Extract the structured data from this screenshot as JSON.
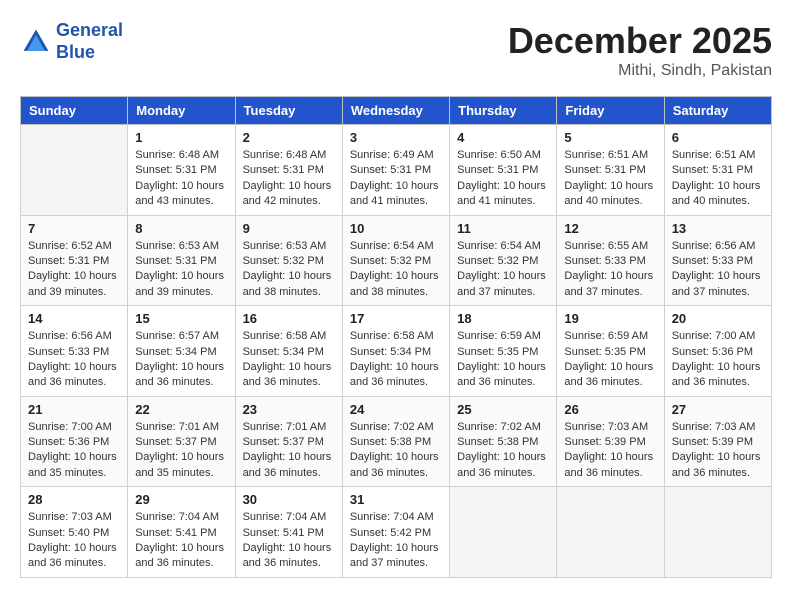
{
  "header": {
    "logo_line1": "General",
    "logo_line2": "Blue",
    "month_year": "December 2025",
    "location": "Mithi, Sindh, Pakistan"
  },
  "weekdays": [
    "Sunday",
    "Monday",
    "Tuesday",
    "Wednesday",
    "Thursday",
    "Friday",
    "Saturday"
  ],
  "weeks": [
    [
      {
        "day": "",
        "empty": true
      },
      {
        "day": "1",
        "sunrise": "6:48 AM",
        "sunset": "5:31 PM",
        "daylight": "10 hours and 43 minutes."
      },
      {
        "day": "2",
        "sunrise": "6:48 AM",
        "sunset": "5:31 PM",
        "daylight": "10 hours and 42 minutes."
      },
      {
        "day": "3",
        "sunrise": "6:49 AM",
        "sunset": "5:31 PM",
        "daylight": "10 hours and 41 minutes."
      },
      {
        "day": "4",
        "sunrise": "6:50 AM",
        "sunset": "5:31 PM",
        "daylight": "10 hours and 41 minutes."
      },
      {
        "day": "5",
        "sunrise": "6:51 AM",
        "sunset": "5:31 PM",
        "daylight": "10 hours and 40 minutes."
      },
      {
        "day": "6",
        "sunrise": "6:51 AM",
        "sunset": "5:31 PM",
        "daylight": "10 hours and 40 minutes."
      }
    ],
    [
      {
        "day": "7",
        "sunrise": "6:52 AM",
        "sunset": "5:31 PM",
        "daylight": "10 hours and 39 minutes."
      },
      {
        "day": "8",
        "sunrise": "6:53 AM",
        "sunset": "5:31 PM",
        "daylight": "10 hours and 39 minutes."
      },
      {
        "day": "9",
        "sunrise": "6:53 AM",
        "sunset": "5:32 PM",
        "daylight": "10 hours and 38 minutes."
      },
      {
        "day": "10",
        "sunrise": "6:54 AM",
        "sunset": "5:32 PM",
        "daylight": "10 hours and 38 minutes."
      },
      {
        "day": "11",
        "sunrise": "6:54 AM",
        "sunset": "5:32 PM",
        "daylight": "10 hours and 37 minutes."
      },
      {
        "day": "12",
        "sunrise": "6:55 AM",
        "sunset": "5:33 PM",
        "daylight": "10 hours and 37 minutes."
      },
      {
        "day": "13",
        "sunrise": "6:56 AM",
        "sunset": "5:33 PM",
        "daylight": "10 hours and 37 minutes."
      }
    ],
    [
      {
        "day": "14",
        "sunrise": "6:56 AM",
        "sunset": "5:33 PM",
        "daylight": "10 hours and 36 minutes."
      },
      {
        "day": "15",
        "sunrise": "6:57 AM",
        "sunset": "5:34 PM",
        "daylight": "10 hours and 36 minutes."
      },
      {
        "day": "16",
        "sunrise": "6:58 AM",
        "sunset": "5:34 PM",
        "daylight": "10 hours and 36 minutes."
      },
      {
        "day": "17",
        "sunrise": "6:58 AM",
        "sunset": "5:34 PM",
        "daylight": "10 hours and 36 minutes."
      },
      {
        "day": "18",
        "sunrise": "6:59 AM",
        "sunset": "5:35 PM",
        "daylight": "10 hours and 36 minutes."
      },
      {
        "day": "19",
        "sunrise": "6:59 AM",
        "sunset": "5:35 PM",
        "daylight": "10 hours and 36 minutes."
      },
      {
        "day": "20",
        "sunrise": "7:00 AM",
        "sunset": "5:36 PM",
        "daylight": "10 hours and 36 minutes."
      }
    ],
    [
      {
        "day": "21",
        "sunrise": "7:00 AM",
        "sunset": "5:36 PM",
        "daylight": "10 hours and 35 minutes."
      },
      {
        "day": "22",
        "sunrise": "7:01 AM",
        "sunset": "5:37 PM",
        "daylight": "10 hours and 35 minutes."
      },
      {
        "day": "23",
        "sunrise": "7:01 AM",
        "sunset": "5:37 PM",
        "daylight": "10 hours and 36 minutes."
      },
      {
        "day": "24",
        "sunrise": "7:02 AM",
        "sunset": "5:38 PM",
        "daylight": "10 hours and 36 minutes."
      },
      {
        "day": "25",
        "sunrise": "7:02 AM",
        "sunset": "5:38 PM",
        "daylight": "10 hours and 36 minutes."
      },
      {
        "day": "26",
        "sunrise": "7:03 AM",
        "sunset": "5:39 PM",
        "daylight": "10 hours and 36 minutes."
      },
      {
        "day": "27",
        "sunrise": "7:03 AM",
        "sunset": "5:39 PM",
        "daylight": "10 hours and 36 minutes."
      }
    ],
    [
      {
        "day": "28",
        "sunrise": "7:03 AM",
        "sunset": "5:40 PM",
        "daylight": "10 hours and 36 minutes."
      },
      {
        "day": "29",
        "sunrise": "7:04 AM",
        "sunset": "5:41 PM",
        "daylight": "10 hours and 36 minutes."
      },
      {
        "day": "30",
        "sunrise": "7:04 AM",
        "sunset": "5:41 PM",
        "daylight": "10 hours and 36 minutes."
      },
      {
        "day": "31",
        "sunrise": "7:04 AM",
        "sunset": "5:42 PM",
        "daylight": "10 hours and 37 minutes."
      },
      {
        "day": "",
        "empty": true
      },
      {
        "day": "",
        "empty": true
      },
      {
        "day": "",
        "empty": true
      }
    ]
  ],
  "labels": {
    "sunrise": "Sunrise:",
    "sunset": "Sunset:",
    "daylight": "Daylight:"
  }
}
